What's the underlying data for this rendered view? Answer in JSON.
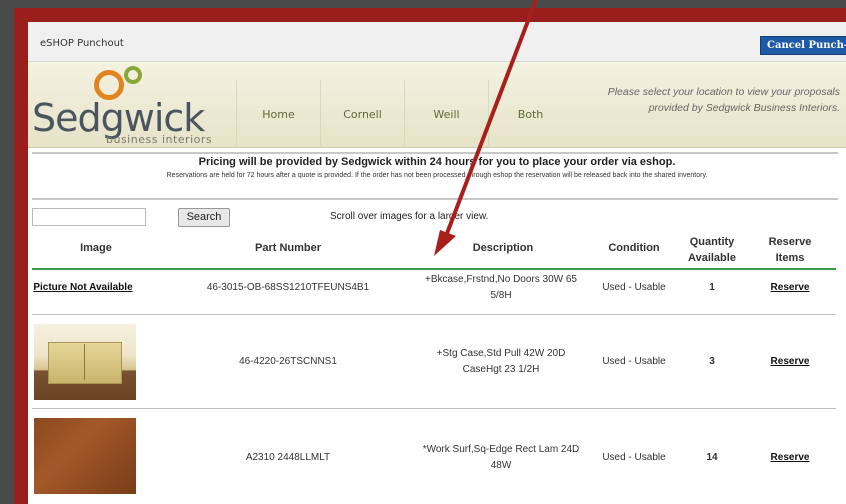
{
  "topbar": {
    "title": "eSHOP Punchout",
    "cancel_label": "Cancel Punch-out"
  },
  "logo": {
    "name": "Sedgwick",
    "subtitle": "business interiors"
  },
  "nav": {
    "items": [
      "Home",
      "Cornell",
      "Weill",
      "Both"
    ]
  },
  "header": {
    "message": "Please select your location to view your proposals provided by Sedgwick Business Interiors."
  },
  "notice": {
    "main": "Pricing will be provided by Sedgwick within 24 hours for you to place your order via eshop.",
    "sub": "Reservations are held for 72 hours after a quote is provided.  If the order has not been processed through eshop the reservation will be released back into the shared inventory."
  },
  "search": {
    "value": "",
    "button_label": "Search",
    "hint": "Scroll over images for a larger view."
  },
  "table": {
    "headers": {
      "image": "Image",
      "part": "Part Number",
      "desc": "Description",
      "condition": "Condition",
      "qty": "Quantity Available",
      "reserve": "Reserve Items"
    },
    "rows": [
      {
        "image_text": "Picture Not Available",
        "part": "46-3015-OB-68SS1210TFEUNS4B1",
        "desc": "+Bkcase,Frstnd,No Doors 30W 65 5/8H",
        "condition": "Used - Usable",
        "qty": "1",
        "reserve": "Reserve"
      },
      {
        "image_text": "",
        "part": "46-4220-26TSCNNS1",
        "desc": "+Stg Case,Std Pull 42W 20D CaseHgt 23 1/2H",
        "condition": "Used - Usable",
        "qty": "3",
        "reserve": "Reserve"
      },
      {
        "image_text": "",
        "part": "A2310 2448LLMLT",
        "desc": "*Work Surf,Sq-Edge Rect Lam 24D 48W",
        "condition": "Used - Usable",
        "qty": "14",
        "reserve": "Reserve"
      }
    ]
  },
  "colors": {
    "frame": "#9a1f1c",
    "cancel_button": "#1e5aa8",
    "header_rule": "#3a9a4a",
    "arrow": "#a8201c"
  }
}
